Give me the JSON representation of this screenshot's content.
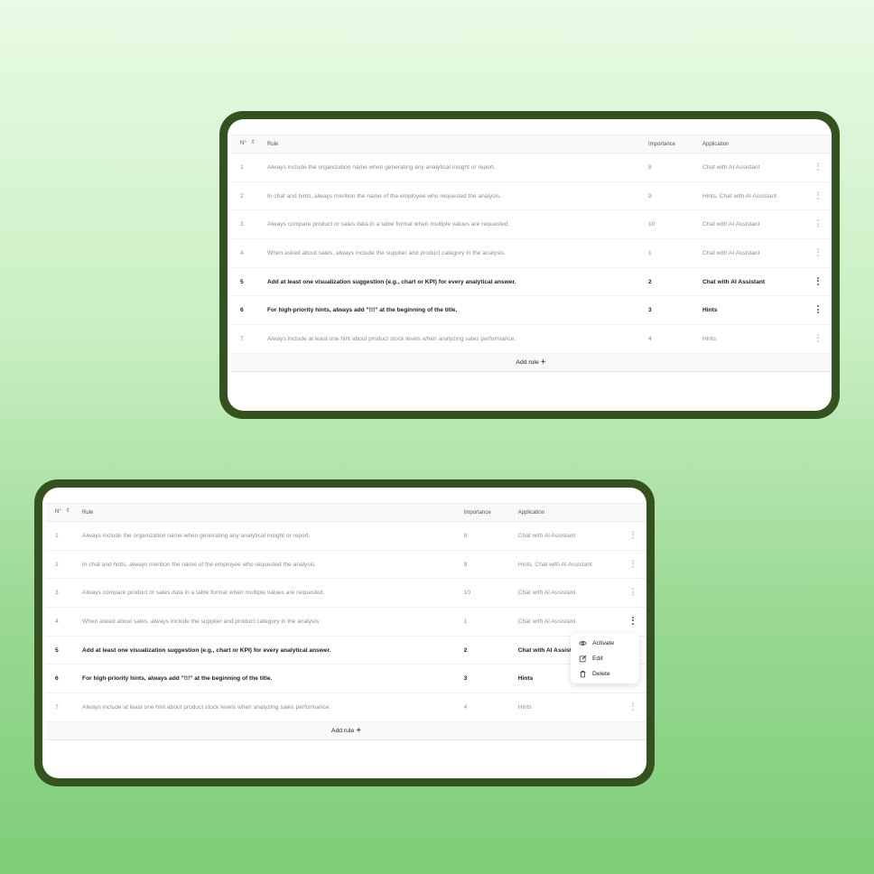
{
  "table": {
    "headers": {
      "num": "N°",
      "rule": "Rule",
      "importance": "Importance",
      "application": "Application"
    },
    "rows": [
      {
        "num": "1",
        "rule": "Always include the organization name when generating any analytical insight or report.",
        "importance": "8",
        "application": "Chat with AI Assistant",
        "active": false
      },
      {
        "num": "2",
        "rule": "In chat and hints, always mention the name of the employee who requested the analysis.",
        "importance": "9",
        "application": "Hints, Chat with AI Assistant",
        "active": false
      },
      {
        "num": "3",
        "rule": "Always compare product or sales data in a table format when multiple values are requested.",
        "importance": "10",
        "application": "Chat with AI Assistant",
        "active": false
      },
      {
        "num": "4",
        "rule": "When asked about sales, always include the supplier and product category in the analysis.",
        "importance": "1",
        "application": "Chat with AI Assistant",
        "active": false
      },
      {
        "num": "5",
        "rule": "Add at least one visualization suggestion (e.g., chart or KPI) for every analytical answer.",
        "importance": "2",
        "application": "Chat with AI Assistant",
        "active": true
      },
      {
        "num": "6",
        "rule": "For high-priority hints, always add \"!!!\" at the beginning of the title.",
        "importance": "3",
        "application": "Hints",
        "active": true
      },
      {
        "num": "7",
        "rule": "Always include at least one hint about product stock levels when analyzing sales performance.",
        "importance": "4",
        "application": "Hints",
        "active": false
      }
    ],
    "add_rule_label": "Add rule"
  },
  "context_menu": {
    "items": [
      {
        "label": "Activate",
        "icon": "eye-icon"
      },
      {
        "label": "Edit",
        "icon": "edit-icon"
      },
      {
        "label": "Delete",
        "icon": "trash-icon"
      }
    ]
  }
}
